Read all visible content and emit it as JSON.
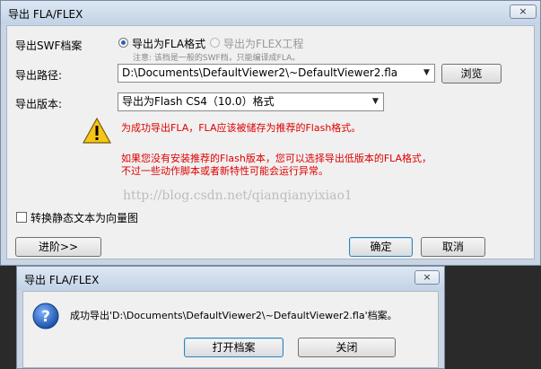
{
  "main_window": {
    "title": "导出 FLA/FLEX",
    "close_symbol": "×",
    "swf_label": "导出SWF档案",
    "radio_fla_label": "导出为FLA格式",
    "radio_flex_label": "导出为FLEX工程",
    "hint": "注意: 该档是一般的SWF档，只能编译成FLA。",
    "path_label": "导出路径:",
    "path_value": "D:\\Documents\\DefaultViewer2\\~DefaultViewer2.fla",
    "browse_label": "浏览",
    "version_label": "导出版本:",
    "version_value": "导出为Flash CS4（10.0）格式",
    "warning_line1": "为成功导出FLA，FLA应该被储存为推荐的Flash格式。",
    "warning_line2": "如果您没有安装推荐的Flash版本，您可以选择导出低版本的FLA格式，",
    "warning_line3": "不过一些动作脚本或者新特性可能会运行异常。",
    "checkbox_label": "转换静态文本为向量图",
    "advanced_label": "进阶>>",
    "ok_label": "确定",
    "cancel_label": "取消",
    "watermark": "http://blog.csdn.net/qianqianyixiao1"
  },
  "message_dialog": {
    "title": "导出 FLA/FLEX",
    "close_symbol": "×",
    "message": "成功导出'D:\\Documents\\DefaultViewer2\\~DefaultViewer2.fla'档案。",
    "open_label": "打开档案",
    "close_label": "关闭"
  },
  "icons": {
    "warning": "warning-icon",
    "info": "question-icon"
  },
  "colors": {
    "warning_text": "#e00000",
    "title_bar": "#c9d5e3",
    "radio_selected": "#2f5fb8"
  }
}
